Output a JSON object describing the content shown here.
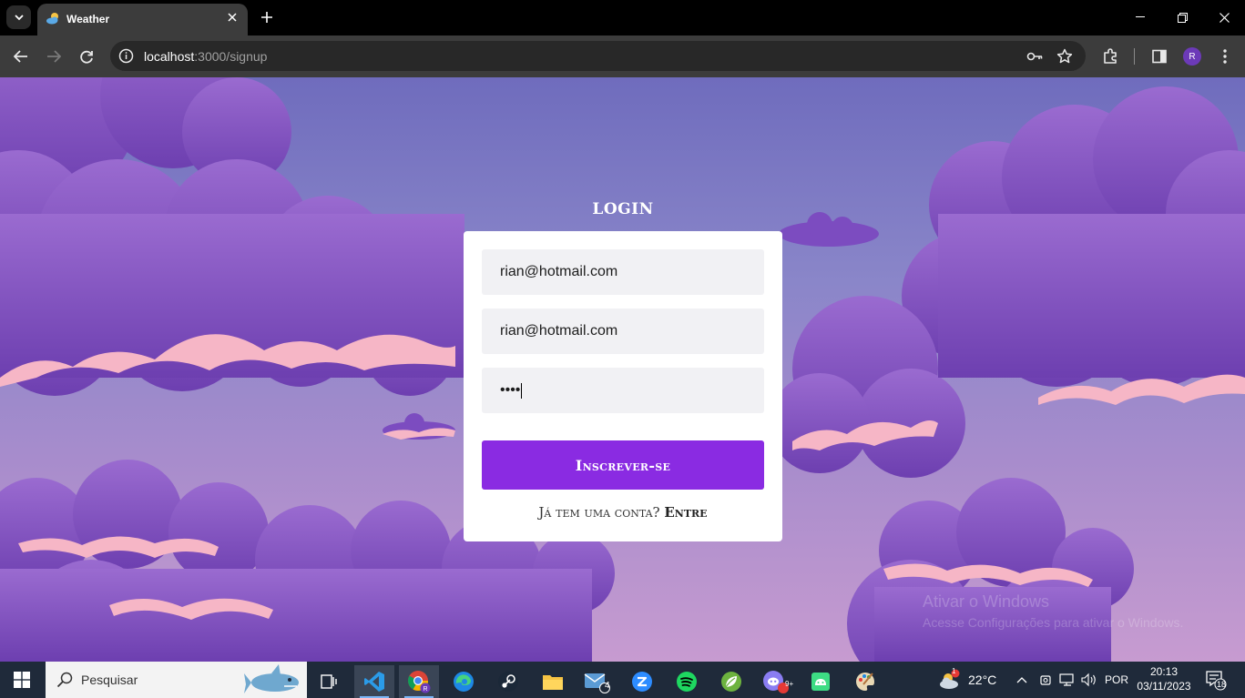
{
  "browser": {
    "tab_title": "Weather",
    "url_host": "localhost",
    "url_path": ":3000/signup",
    "profile_initial": "R"
  },
  "form": {
    "heading": "LOGIN",
    "name_value": "rian@hotmail.com",
    "email_value": "rian@hotmail.com",
    "password_value": "••••",
    "submit_label": "Inscrever-se",
    "switch_text": "Já tem uma conta?",
    "switch_link": "Entre"
  },
  "watermark": {
    "line1": "Ativar o Windows",
    "line2": "Acesse Configurações para ativar o Windows."
  },
  "taskbar": {
    "search_placeholder": "Pesquisar",
    "mail_badge": "4",
    "discord_badge": "9+",
    "weather_temp": "22°C",
    "weather_badge": "1",
    "language": "POR",
    "time": "20:13",
    "date": "03/11/2023",
    "notifications": "18"
  },
  "colors": {
    "accent": "#8a2be2",
    "page_sky": "#7a76c4",
    "cloud": "#8b5cc4",
    "cloud_highlight": "#f6b6c6"
  }
}
